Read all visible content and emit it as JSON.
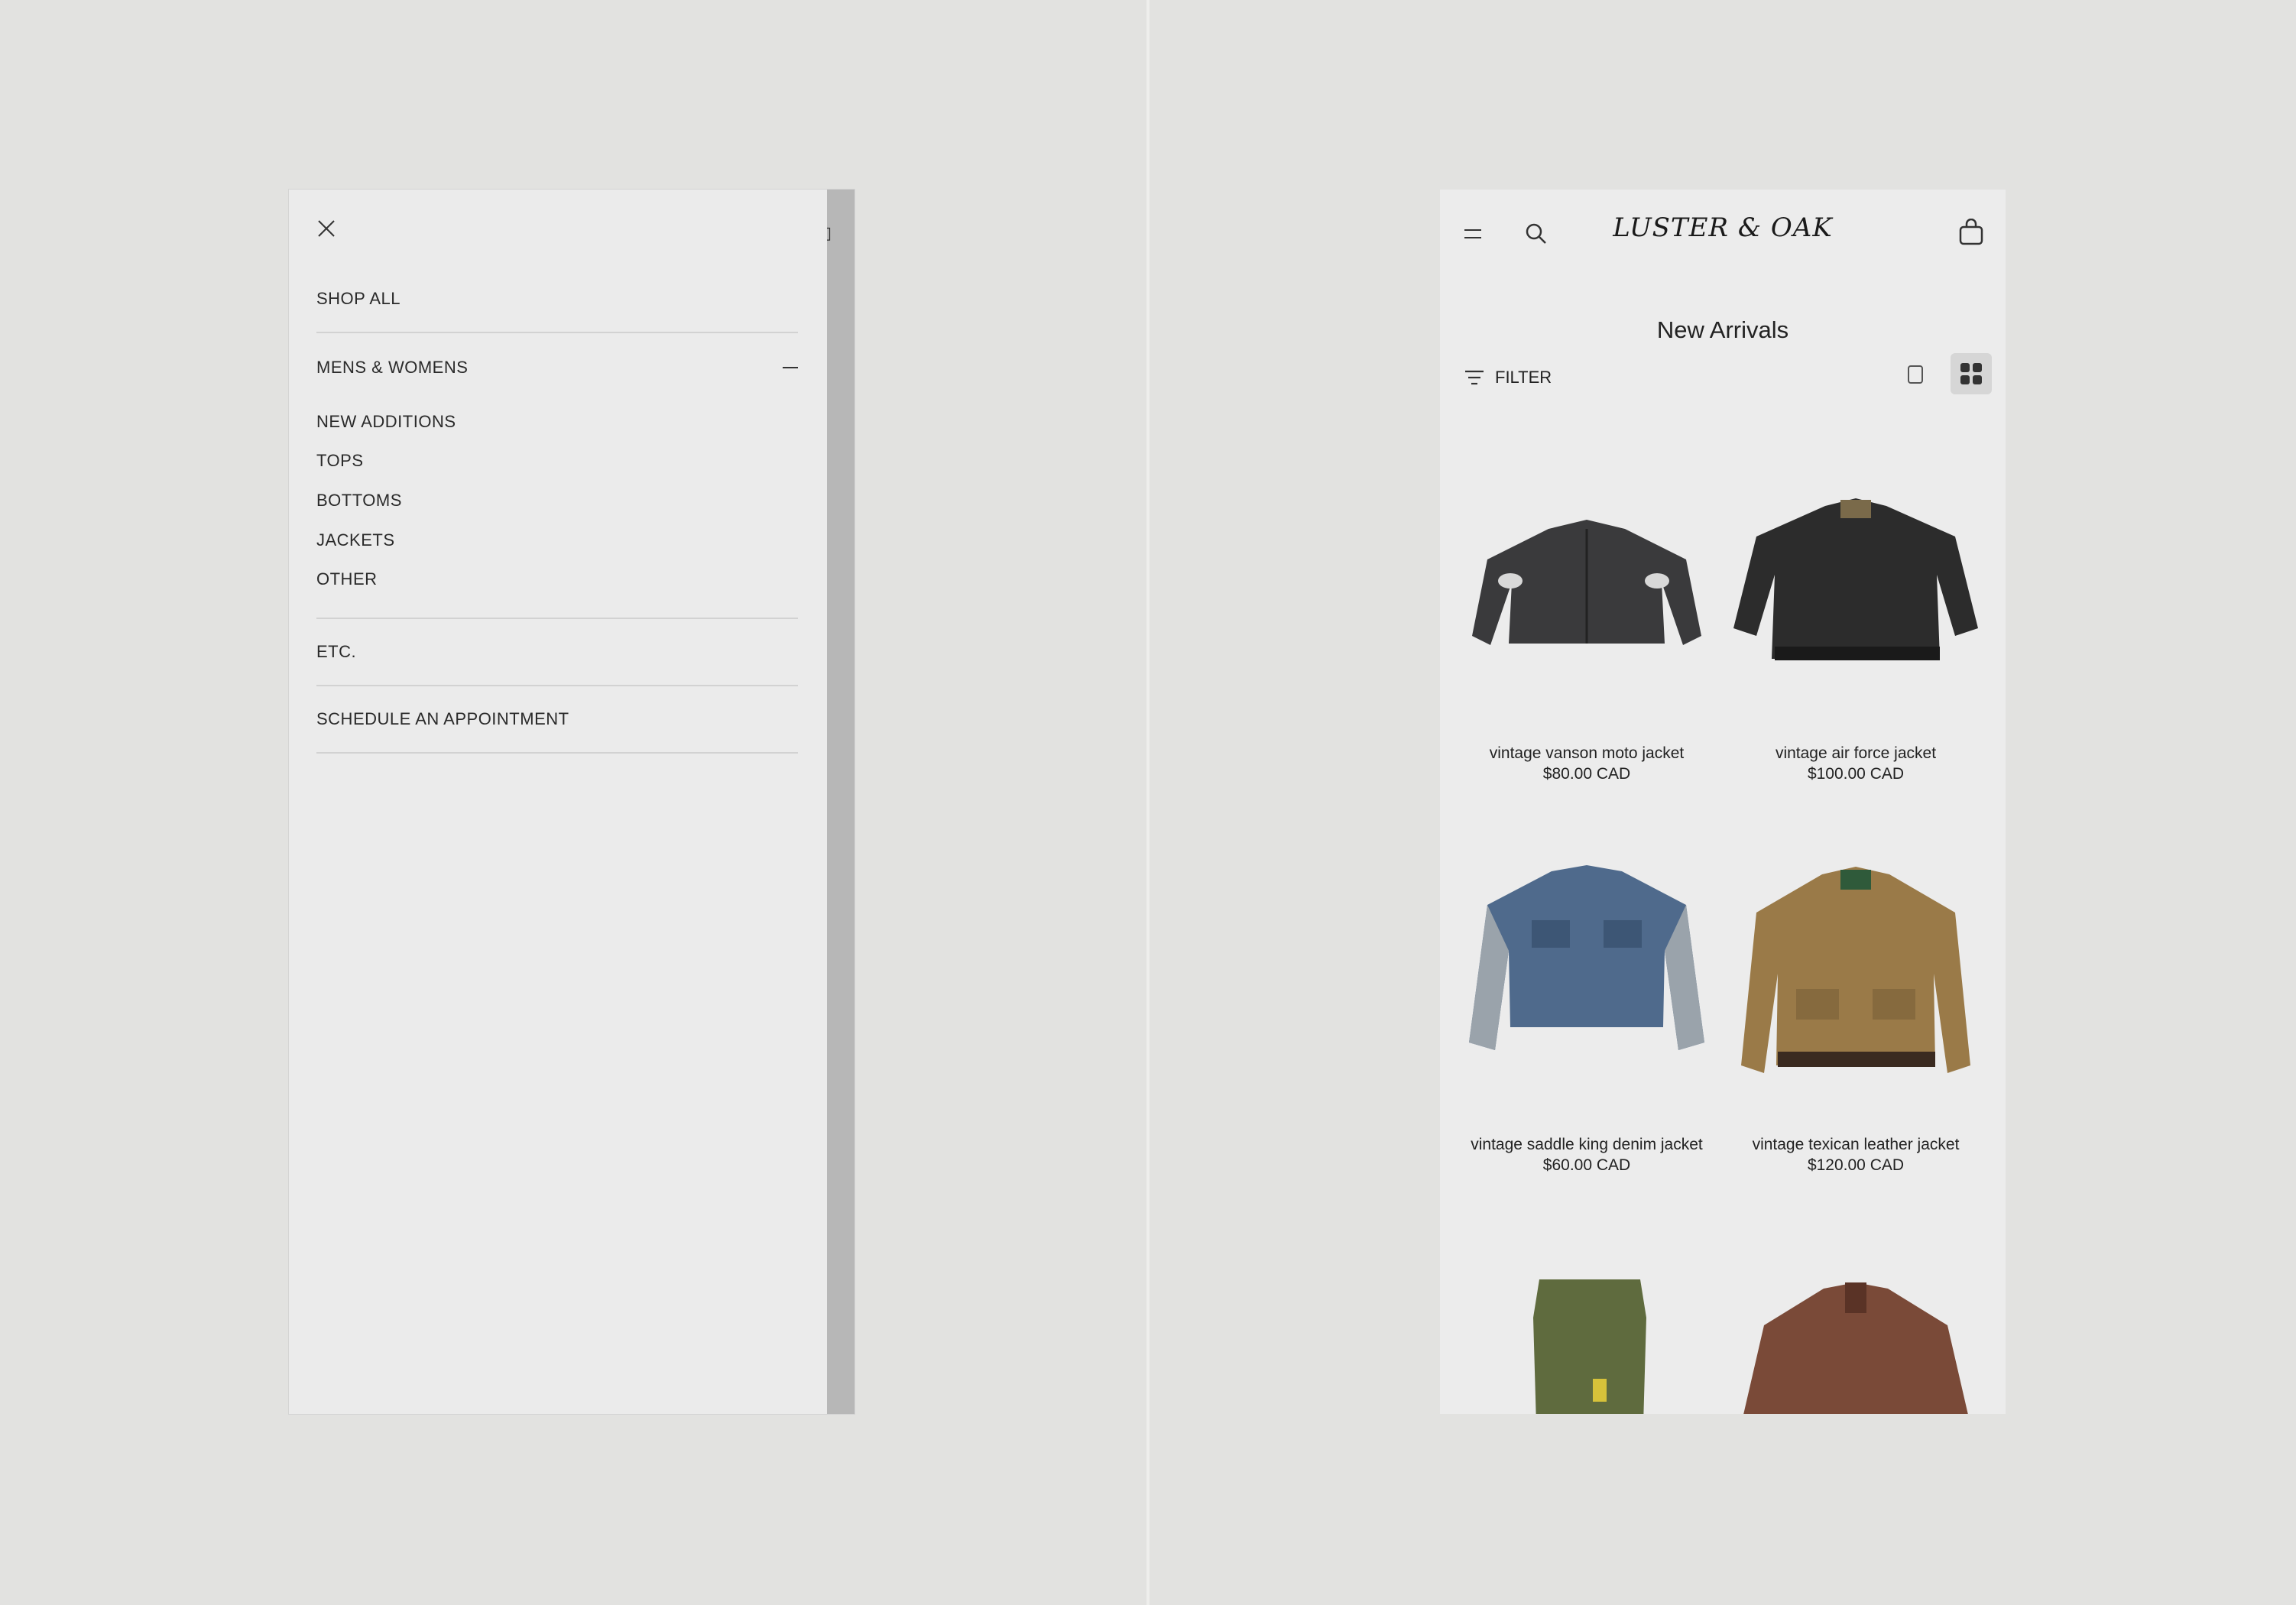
{
  "menu": {
    "items": [
      {
        "label": "SHOP ALL"
      },
      {
        "label": "MENS & WOMENS"
      },
      {
        "label": "ETC."
      },
      {
        "label": "SCHEDULE AN APPOINTMENT"
      }
    ],
    "submenu": [
      {
        "label": "NEW ADDITIONS"
      },
      {
        "label": "TOPS"
      },
      {
        "label": "BOTTOMS"
      },
      {
        "label": "JACKETS"
      },
      {
        "label": "OTHER"
      }
    ]
  },
  "store": {
    "logo": "LUSTER & OAK",
    "page_title": "New Arrivals",
    "filter_label": "FILTER",
    "products": [
      {
        "name": "vintage vanson moto jacket",
        "price": "$80.00 CAD",
        "color": "#3a3a3c"
      },
      {
        "name": "vintage air force jacket",
        "price": "$100.00 CAD",
        "color": "#2c2c2c"
      },
      {
        "name": "vintage saddle king denim jacket",
        "price": "$60.00 CAD",
        "color": "#4f6a8c"
      },
      {
        "name": "vintage texican leather jacket",
        "price": "$120.00 CAD",
        "color": "#9a7a48"
      },
      {
        "name": "",
        "price": "",
        "color": "#5f6b3e"
      },
      {
        "name": "",
        "price": "",
        "color": "#7a4a38"
      }
    ]
  },
  "colors": {
    "background": "#e2e2e0",
    "panel": "#ebebeb",
    "overlay": "#b7b7b7",
    "text": "#222222"
  }
}
